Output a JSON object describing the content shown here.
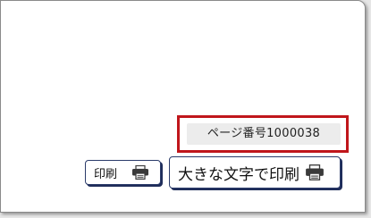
{
  "page_id": {
    "text": "ページ番号1000038"
  },
  "buttons": {
    "print_label": "印刷",
    "large_print_label": "大きな文字で印刷"
  },
  "icons": {
    "printer": "printer-icon"
  },
  "colors": {
    "highlight_border": "#c0161b",
    "button_border": "#2b3b6a",
    "button_shadow": "#1f2d5a",
    "badge_background": "#ececec"
  }
}
